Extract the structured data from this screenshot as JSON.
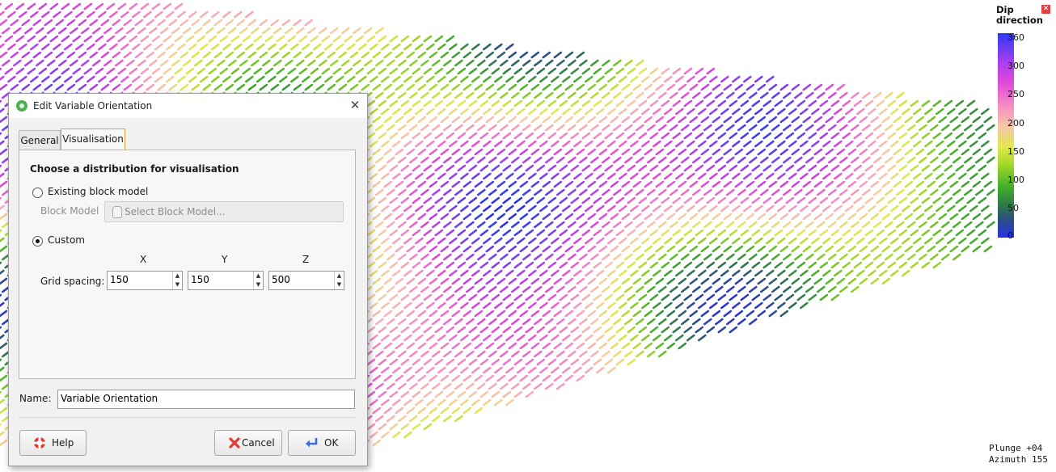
{
  "viewer": {
    "legend": {
      "title": "Dip direction",
      "close_icon": "close-icon",
      "ticks": [
        "360",
        "300",
        "250",
        "200",
        "150",
        "100",
        "50",
        "0"
      ]
    },
    "status": {
      "plunge": "Plunge +04",
      "azimuth": "Azimuth 155"
    }
  },
  "dialog": {
    "title": "Edit Variable Orientation",
    "tabs": [
      {
        "label": "General",
        "active": false
      },
      {
        "label": "Visualisation",
        "active": true
      }
    ],
    "heading": "Choose a distribution for visualisation",
    "existing_block_model": {
      "label": "Existing block model",
      "selected": false
    },
    "block_model": {
      "label": "Block Model",
      "button": "Select Block Model..."
    },
    "custom": {
      "label": "Custom",
      "selected": true
    },
    "grid": {
      "label": "Grid spacing:",
      "axes": [
        "X",
        "Y",
        "Z"
      ],
      "values": [
        "150",
        "150",
        "500"
      ]
    },
    "name": {
      "label": "Name:",
      "value": "Variable Orientation"
    },
    "buttons": {
      "help": "Help",
      "cancel": "Cancel",
      "ok": "OK"
    }
  }
}
